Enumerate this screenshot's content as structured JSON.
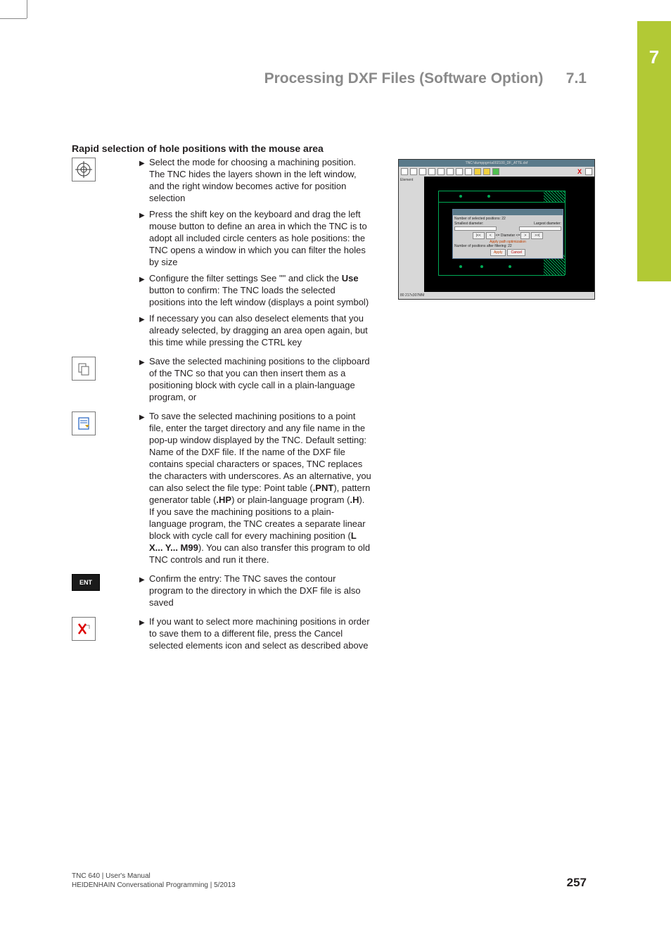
{
  "chapter_tab": "7",
  "header": {
    "title": "Processing DXF Files (Software Option)",
    "section": "7.1"
  },
  "section_heading": "Rapid selection of hole positions with the mouse area",
  "steps": [
    {
      "icon": "target-icon",
      "text": "Select the mode for choosing a machining position. The TNC hides the layers shown in the left window, and the right window becomes active for position selection"
    },
    {
      "icon": null,
      "text": "Press the shift key on the keyboard and drag the left mouse button to define an area in which the TNC is to adopt all included circle centers as hole positions: the TNC opens a window in which you can filter the holes by size"
    },
    {
      "icon": null,
      "text_pre": "Configure the filter settings See \"\" and click the ",
      "bold1": "Use",
      "text_post": " button to confirm: The TNC loads the selected positions into the left window (displays a point symbol)"
    },
    {
      "icon": null,
      "text": "If necessary you can also deselect elements that you already selected, by dragging an area open again, but this time while pressing the CTRL key"
    },
    {
      "icon": "clipboard-icon",
      "text": "Save the selected machining positions to the clipboard of the TNC so that you can then insert them as a positioning block with cycle call in a plain-language program, or"
    },
    {
      "icon": "save-file-icon",
      "text_pre": "To save the selected machining positions to a point file, enter the target directory and any file name in the pop-up window displayed by the TNC. Default setting: Name of the DXF file. If the name of the DXF file contains special characters or spaces, TNC replaces the characters with underscores. As an alternative, you can also select the file type: Point table (",
      "bold1": ".PNT",
      "mid1": "), pattern generator table (",
      "bold2": ".HP",
      "mid2": ") or plain-language program (",
      "bold3": ".H",
      "mid3": "). If you save the machining positions to a plain-language program, the TNC creates a separate linear block with cycle call for every machining position (",
      "bold4": "L X... Y... M99",
      "text_post": "). You can also transfer this program to old TNC controls and run it there."
    },
    {
      "icon": "ent-key",
      "icon_label": "ENT",
      "text": "Confirm the entry: The TNC saves the contour program to the directory in which the DXF file is also saved"
    },
    {
      "icon": "cancel-x-icon",
      "text": "If you want to select more machining positions in order to save them to a different file, press the Cancel selected elements icon and select as described above"
    }
  ],
  "screenshot": {
    "title": "TNC:\\dumppgm\\a002100_DF_ATTE.dxf",
    "sidebar_label": "Element",
    "dialog": {
      "title": "",
      "line1": "Number of selected positions: 22",
      "small_label": "Smallest diameter:",
      "large_label": "Largest diameter:",
      "diameter_label": "<= Diameter <=",
      "apply_label": "Apply path optimization",
      "line2": "Number of positions after filtering: 22",
      "apply_btn": "Apply",
      "cancel_btn": "Cancel"
    },
    "status": "80   217x307MM"
  },
  "footer": {
    "line1": "TNC 640 | User's Manual",
    "line2": "HEIDENHAIN Conversational Programming | 5/2013",
    "page": "257"
  }
}
